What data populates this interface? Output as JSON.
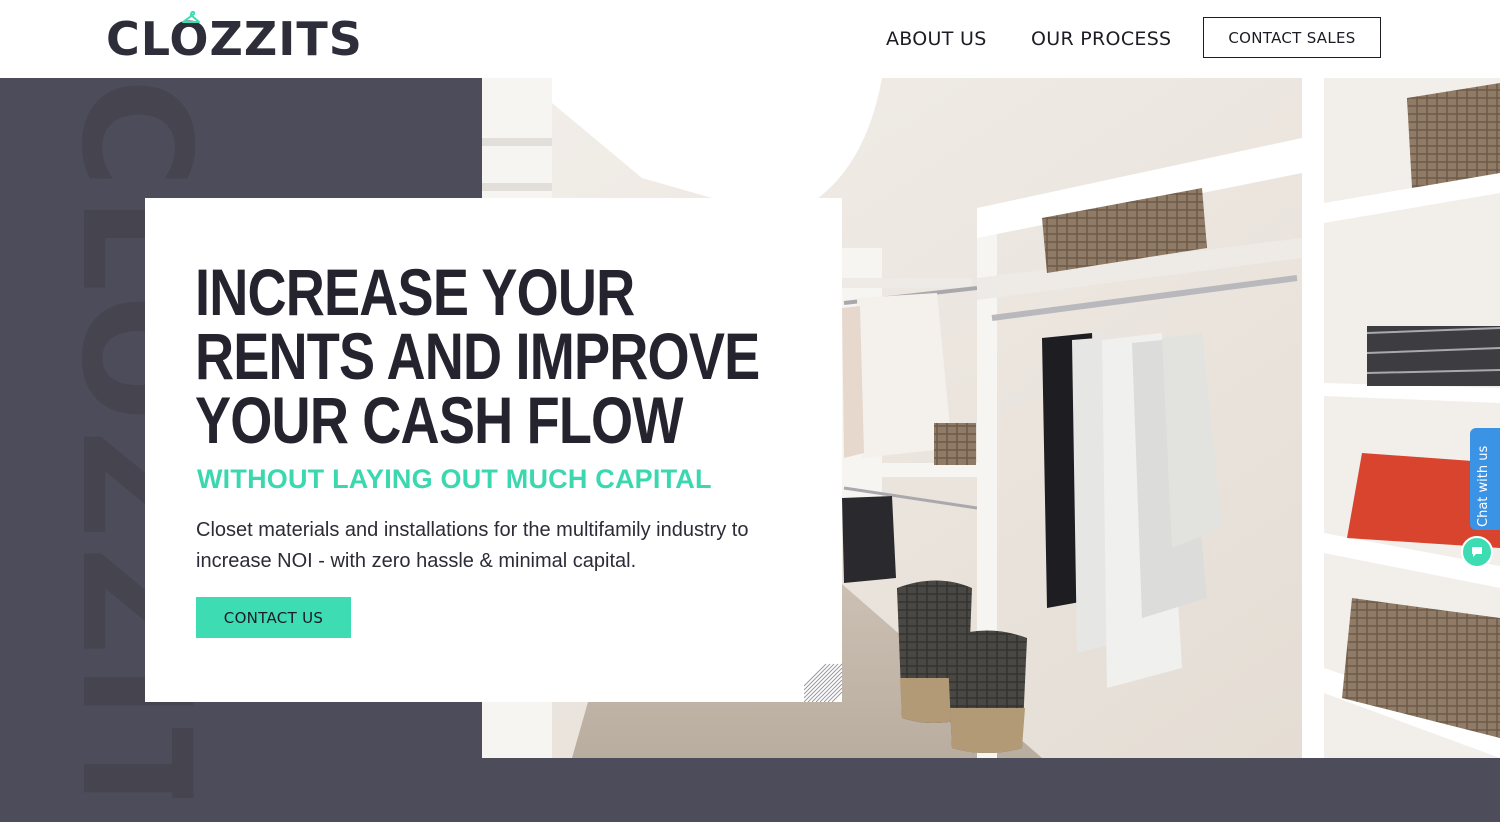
{
  "brand": {
    "logo_text": "CLOZZITS",
    "watermark_text": "CLOZZITS"
  },
  "nav": {
    "items": [
      {
        "label": "ABOUT US"
      },
      {
        "label": "OUR PROCESS"
      }
    ],
    "cta_label": "CONTACT SALES"
  },
  "hero": {
    "headline_lines": [
      "INCREASE YOUR",
      "RENTS AND IMPROVE",
      "YOUR CASH FLOW"
    ],
    "subheadline": "WITHOUT LAYING OUT MUCH CAPITAL",
    "description": "Closet materials and installations for the multifamily industry to increase NOI - with zero hassle & minimal capital.",
    "cta_label": "CONTACT US",
    "image_icon": "closet-photo"
  },
  "chat": {
    "label": "Chat with us",
    "icon": "chat-bubble-icon"
  },
  "colors": {
    "accent": "#3ddcb2",
    "dark": "#24232e",
    "background": "#4d4c5a",
    "chat": "#3b93e6"
  }
}
